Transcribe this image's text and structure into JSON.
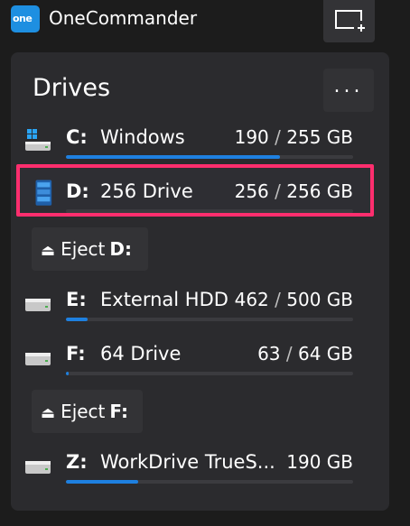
{
  "app": {
    "logo_text": "one",
    "title": "OneCommander",
    "accent": "#1e8fe1"
  },
  "panel": {
    "title": "Drives",
    "more_label": "..."
  },
  "drives": [
    {
      "letter": "C:",
      "name": "Windows",
      "used": "190",
      "separator": " / ",
      "total": "255 GB",
      "fill": 0.745,
      "icon": "windows-drive-icon",
      "bar_color": "#1e80e0"
    },
    {
      "letter": "D:",
      "name": "256 Drive",
      "used": "256",
      "separator": " / ",
      "total": "256 GB",
      "fill": 1.0,
      "icon": "removable-drive-icon",
      "bar_color": "#3b3b3f",
      "selected": true
    },
    {
      "letter": "E:",
      "name": "External HDD",
      "used": "462",
      "separator": " / ",
      "total": "500 GB",
      "fill": 0.075,
      "icon": "hdd-icon",
      "bar_color": "#1e80e0"
    },
    {
      "letter": "F:",
      "name": "64 Drive",
      "used": "63",
      "separator": " / ",
      "total": "64 GB",
      "fill": 0.01,
      "icon": "hdd-icon",
      "bar_color": "#1e80e0"
    },
    {
      "letter": "Z:",
      "name": "WorkDrive TrueS...",
      "used": "190 GB",
      "separator": "",
      "total": "",
      "fill": 0.25,
      "icon": "hdd-icon",
      "bar_color": "#1e80e0"
    }
  ],
  "eject": [
    {
      "label": "Eject",
      "letter": "D:"
    },
    {
      "label": "Eject",
      "letter": "F:"
    }
  ]
}
